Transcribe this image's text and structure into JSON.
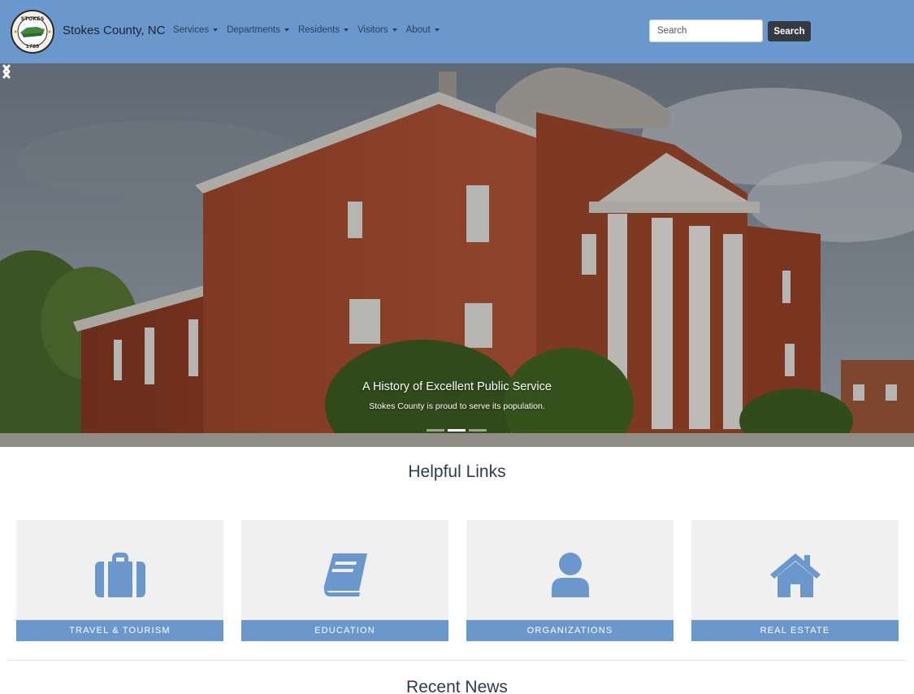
{
  "header": {
    "brand": "Stokes County, NC",
    "logo_icon": "county-seal-icon",
    "nav": [
      {
        "label": "Services"
      },
      {
        "label": "Departments"
      },
      {
        "label": "Residents"
      },
      {
        "label": "Visitors"
      },
      {
        "label": "About"
      }
    ],
    "search": {
      "placeholder": "Search",
      "value": "",
      "button_label": "Search"
    }
  },
  "carousel": {
    "title": "A History of Excellent Public Service",
    "subtitle": "Stokes County is proud to serve its population.",
    "slide_count": 3,
    "active_slide": 2,
    "prev_icon": "chevron-left-icon",
    "next_icon": "chevron-right-icon"
  },
  "helpful_links": {
    "title": "Helpful Links",
    "cards": [
      {
        "label": "TRAVEL & TOURISM",
        "icon": "suitcase-icon"
      },
      {
        "label": "EDUCATION",
        "icon": "book-icon"
      },
      {
        "label": "ORGANIZATIONS",
        "icon": "user-icon"
      },
      {
        "label": "REAL ESTATE",
        "icon": "house-icon"
      }
    ]
  },
  "recent_news": {
    "title": "Recent News"
  },
  "colors": {
    "brand": "#6a98cd",
    "button_dark": "#343a40",
    "card_bg": "#f0f0f0",
    "heading": "#2c3b52"
  }
}
